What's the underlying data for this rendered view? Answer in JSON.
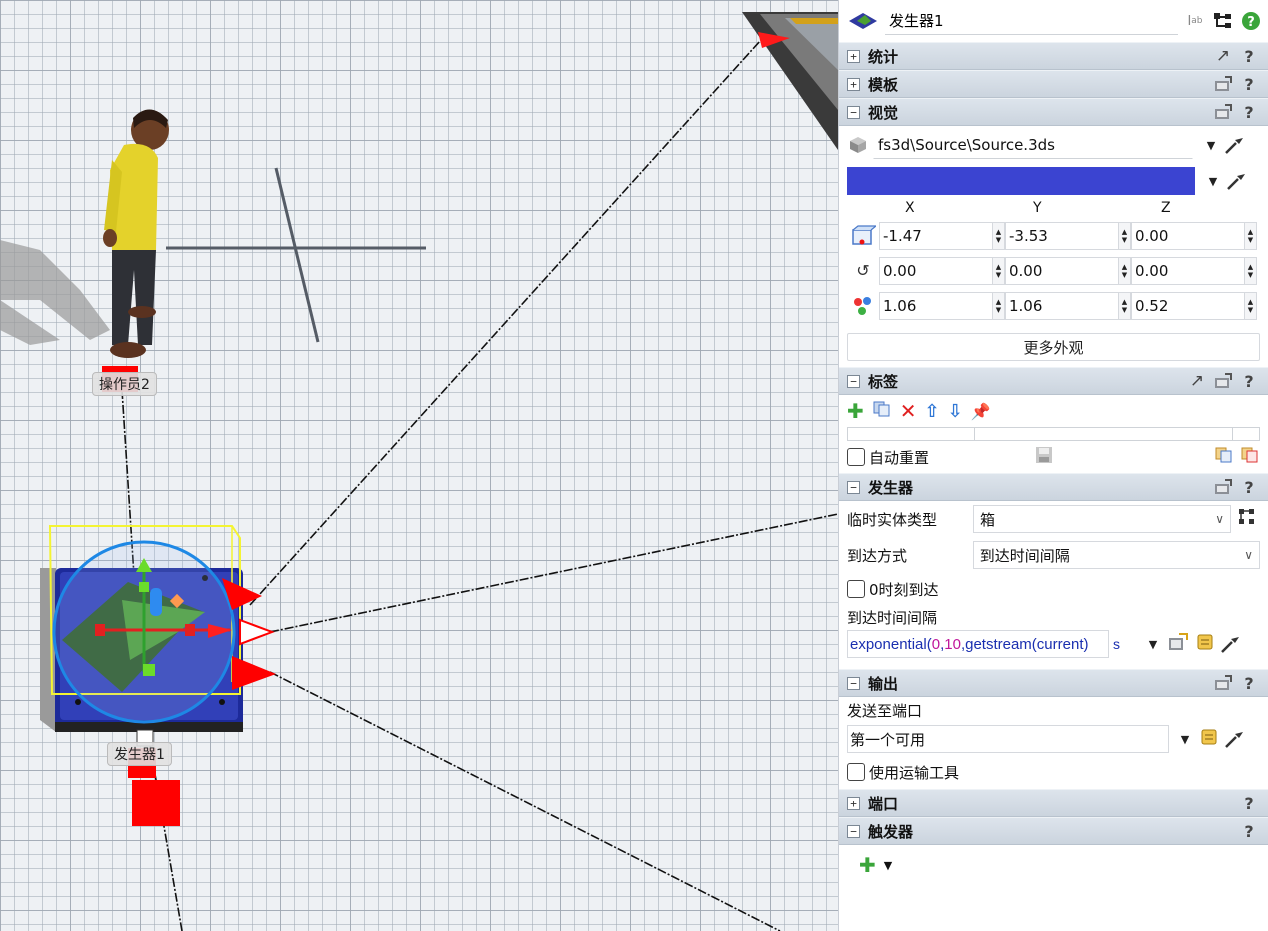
{
  "viewport": {
    "operator_label": "操作员2",
    "source_label": "发生器1"
  },
  "panel": {
    "object_name": "发生器1",
    "sections": {
      "stats": "统计",
      "template": "模板",
      "visual": "视觉",
      "labels": "标签",
      "source": "发生器",
      "output": "输出",
      "ports": "端口",
      "triggers": "触发器"
    },
    "visual": {
      "shape_file": "fs3d\\Source\\Source.3ds",
      "color": "#3b44d1",
      "axis_x": "X",
      "axis_y": "Y",
      "axis_z": "Z",
      "position": [
        "-1.47",
        "-3.53",
        "0.00"
      ],
      "rotation": [
        "0.00",
        "0.00",
        "0.00"
      ],
      "size": [
        "1.06",
        "1.06",
        "0.52"
      ],
      "more_appearance": "更多外观"
    },
    "labels": {
      "auto_reset": "自动重置"
    },
    "source": {
      "item_type_label": "临时实体类型",
      "item_type_value": "箱",
      "arrival_style_label": "到达方式",
      "arrival_style_value": "到达时间间隔",
      "arrive_at_zero_label": "0时刻到达",
      "interarrival_label": "到达时间间隔",
      "interarrival_fn": "exponential(",
      "interarrival_a": "0",
      "interarrival_sep1": ", ",
      "interarrival_b": "10",
      "interarrival_sep2": ", ",
      "interarrival_rest": "getstream(current)",
      "interarrival_unit": "s"
    },
    "output": {
      "send_to_port_label": "发送至端口",
      "send_to_port_value": "第一个可用",
      "use_transport_label": "使用运输工具"
    }
  }
}
